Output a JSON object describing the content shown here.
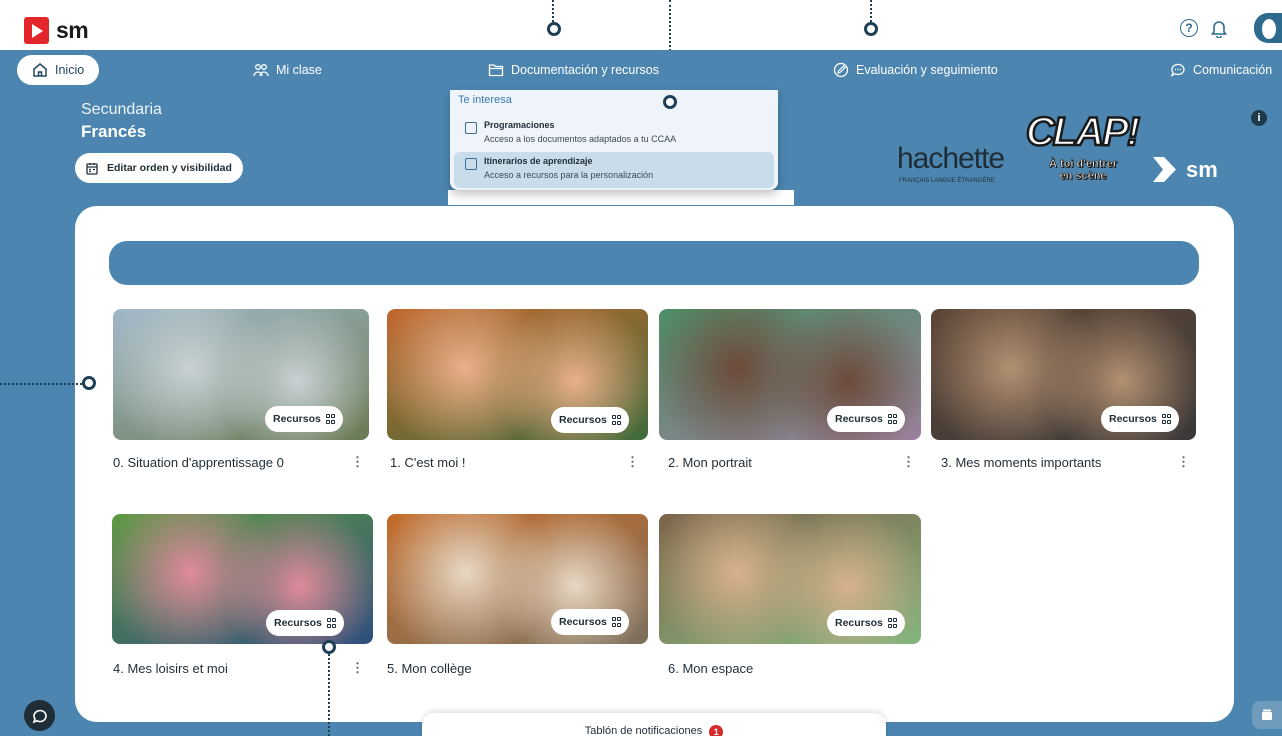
{
  "brand": {
    "name": "sm"
  },
  "nav": {
    "items": [
      {
        "label": "Inicio",
        "icon": "home-icon",
        "active": true
      },
      {
        "label": "Mi clase",
        "icon": "people-icon"
      },
      {
        "label": "Documentación y recursos",
        "icon": "folder-icon"
      },
      {
        "label": "Evaluación y seguimiento",
        "icon": "pencil-icon"
      },
      {
        "label": "Comunicación",
        "icon": "chat-icon"
      }
    ]
  },
  "header": {
    "level": "Secundaria",
    "subject": "Francés",
    "edit_button": "Editar orden y visibilidad",
    "help_glyph": "?",
    "info_glyph": "i"
  },
  "dropdown": {
    "heading": "Te interesa",
    "items": [
      {
        "title": "Programaciones",
        "description": "Acceso a los documentos adaptados a tu CCAA"
      },
      {
        "title": "Itinerarios de aprendizaje",
        "description": "Acceso a recursos para la personalización",
        "selected": true
      }
    ]
  },
  "brands": {
    "hachette": "hachette",
    "hachette_sub": "FRANÇAIS LANGUE ÉTRANGÈRE",
    "clap_title": "CLAP!",
    "clap_sub_1": "À toi d'entrer",
    "clap_sub_2": "en scène",
    "sm": "sm"
  },
  "units": [
    {
      "title": "0. Situation d'apprentissage 0",
      "resources": "Recursos",
      "palette": [
        "#9fb7c9",
        "#c8d1d3",
        "#6b7a52"
      ]
    },
    {
      "title": "1. C'est moi !",
      "resources": "Recursos",
      "palette": [
        "#c2672c",
        "#e9b08c",
        "#3e6b3a"
      ]
    },
    {
      "title": "2. Mon portrait",
      "resources": "Recursos",
      "palette": [
        "#4b8f66",
        "#6d4a3a",
        "#9a7f9b"
      ]
    },
    {
      "title": "3. Mes moments importants",
      "resources": "Recursos",
      "palette": [
        "#5d4636",
        "#b39072",
        "#3a3838"
      ]
    },
    {
      "title": "4. Mes loisirs et moi",
      "resources": "Recursos",
      "palette": [
        "#5d9a42",
        "#e08a9a",
        "#2d4d7c"
      ]
    },
    {
      "title": "5. Mon collège",
      "resources": "Recursos",
      "palette": [
        "#c46a28",
        "#e8d8c4",
        "#7a6f5d"
      ]
    },
    {
      "title": "6. Mon espace",
      "resources": "Recursos",
      "palette": [
        "#7a6248",
        "#d8b28c",
        "#84b57f"
      ]
    }
  ],
  "notifications": {
    "label": "Tablón de notificaciones",
    "count": "1"
  },
  "colors": {
    "primary": "#4c86b0",
    "dark": "#1f2d37",
    "accent": "#e3262c"
  }
}
